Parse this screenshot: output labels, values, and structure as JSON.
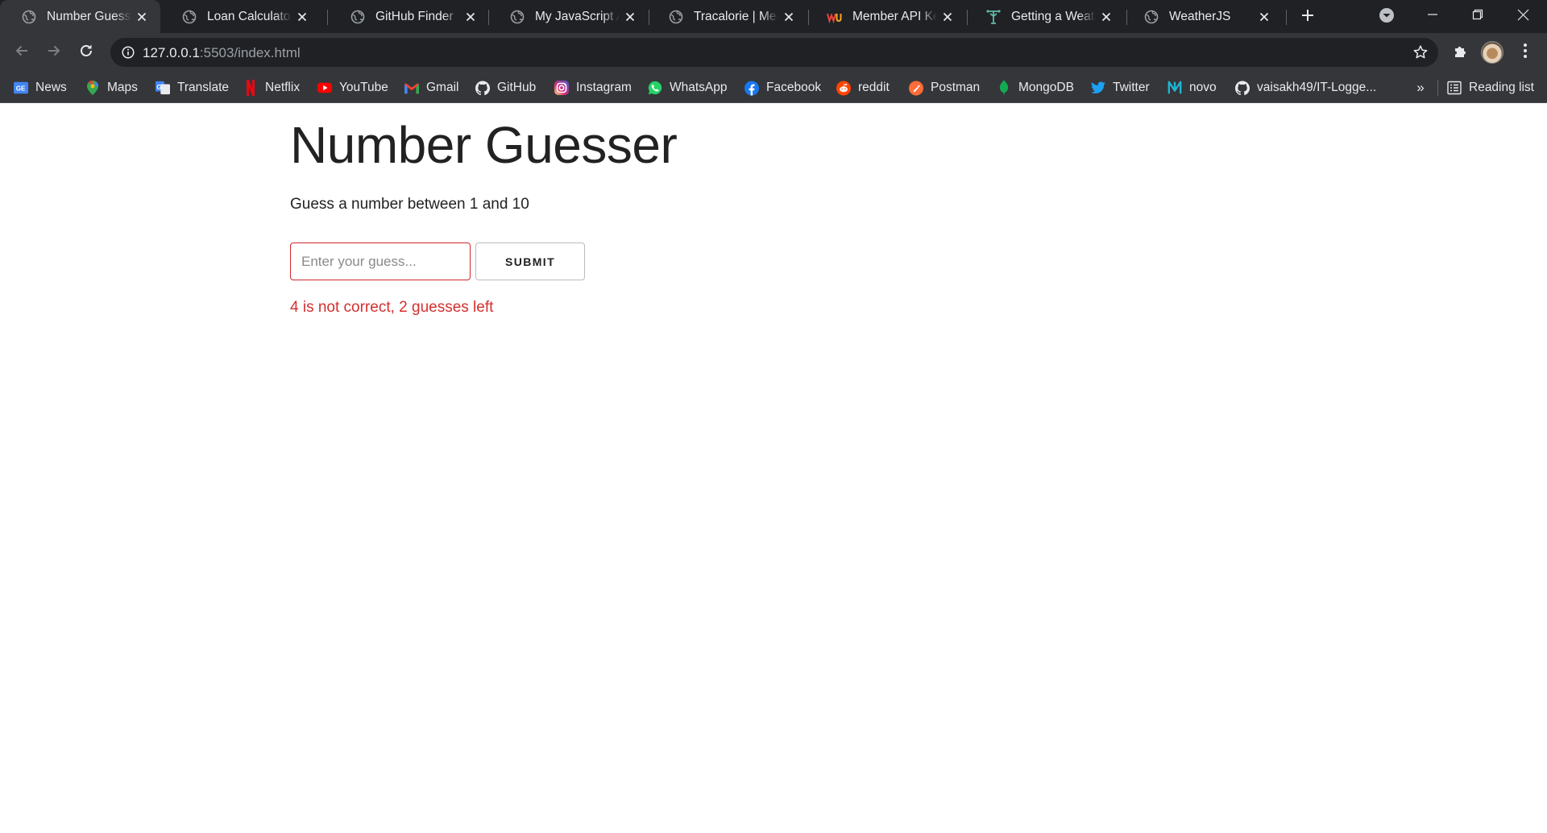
{
  "colors": {
    "tabstrip_bg": "#202124",
    "toolbar_bg": "#35363a",
    "error_red": "#d0262b",
    "message_red": "#d42f2f"
  },
  "tabs": [
    {
      "title": "Number Guesser",
      "icon": "globe-icon",
      "active": true
    },
    {
      "title": "Loan Calculator",
      "icon": "globe-icon",
      "active": false
    },
    {
      "title": "GitHub Finder",
      "icon": "globe-icon",
      "active": false
    },
    {
      "title": "My JavaScript App",
      "icon": "globe-icon",
      "active": false
    },
    {
      "title": "Tracalorie | Meal & Calorie Tracker",
      "icon": "globe-icon",
      "active": false
    },
    {
      "title": "Member API Keys",
      "icon": "wunderground-icon",
      "active": false
    },
    {
      "title": "Getting a Weather Forecast",
      "icon": "weather-tower-icon",
      "active": false
    },
    {
      "title": "WeatherJS",
      "icon": "globe-icon",
      "active": false
    }
  ],
  "address_bar": {
    "host": "127.0.0.1",
    "path": ":5503/index.html"
  },
  "bookmarks": [
    {
      "label": "News",
      "icon": "google-news-icon"
    },
    {
      "label": "Maps",
      "icon": "google-maps-icon"
    },
    {
      "label": "Translate",
      "icon": "google-translate-icon"
    },
    {
      "label": "Netflix",
      "icon": "netflix-icon"
    },
    {
      "label": "YouTube",
      "icon": "youtube-icon"
    },
    {
      "label": "Gmail",
      "icon": "gmail-icon"
    },
    {
      "label": "GitHub",
      "icon": "github-icon"
    },
    {
      "label": "Instagram",
      "icon": "instagram-icon"
    },
    {
      "label": "WhatsApp",
      "icon": "whatsapp-icon"
    },
    {
      "label": "Facebook",
      "icon": "facebook-icon"
    },
    {
      "label": "reddit",
      "icon": "reddit-icon"
    },
    {
      "label": "Postman",
      "icon": "postman-icon"
    },
    {
      "label": "MongoDB",
      "icon": "mongodb-icon"
    },
    {
      "label": "Twitter",
      "icon": "twitter-icon"
    },
    {
      "label": "novo",
      "icon": "novo-icon"
    },
    {
      "label": "vaisakh49/IT-Logge...",
      "icon": "github-icon"
    }
  ],
  "bookmarks_more": "»",
  "reading_list": "Reading list",
  "page": {
    "heading": "Number Guesser",
    "instructions": "Guess a number between 1 and 10",
    "guess_placeholder": "Enter your guess...",
    "guess_value": "",
    "submit_label": "SUBMIT",
    "message": "4 is not correct, 2 guesses left"
  }
}
